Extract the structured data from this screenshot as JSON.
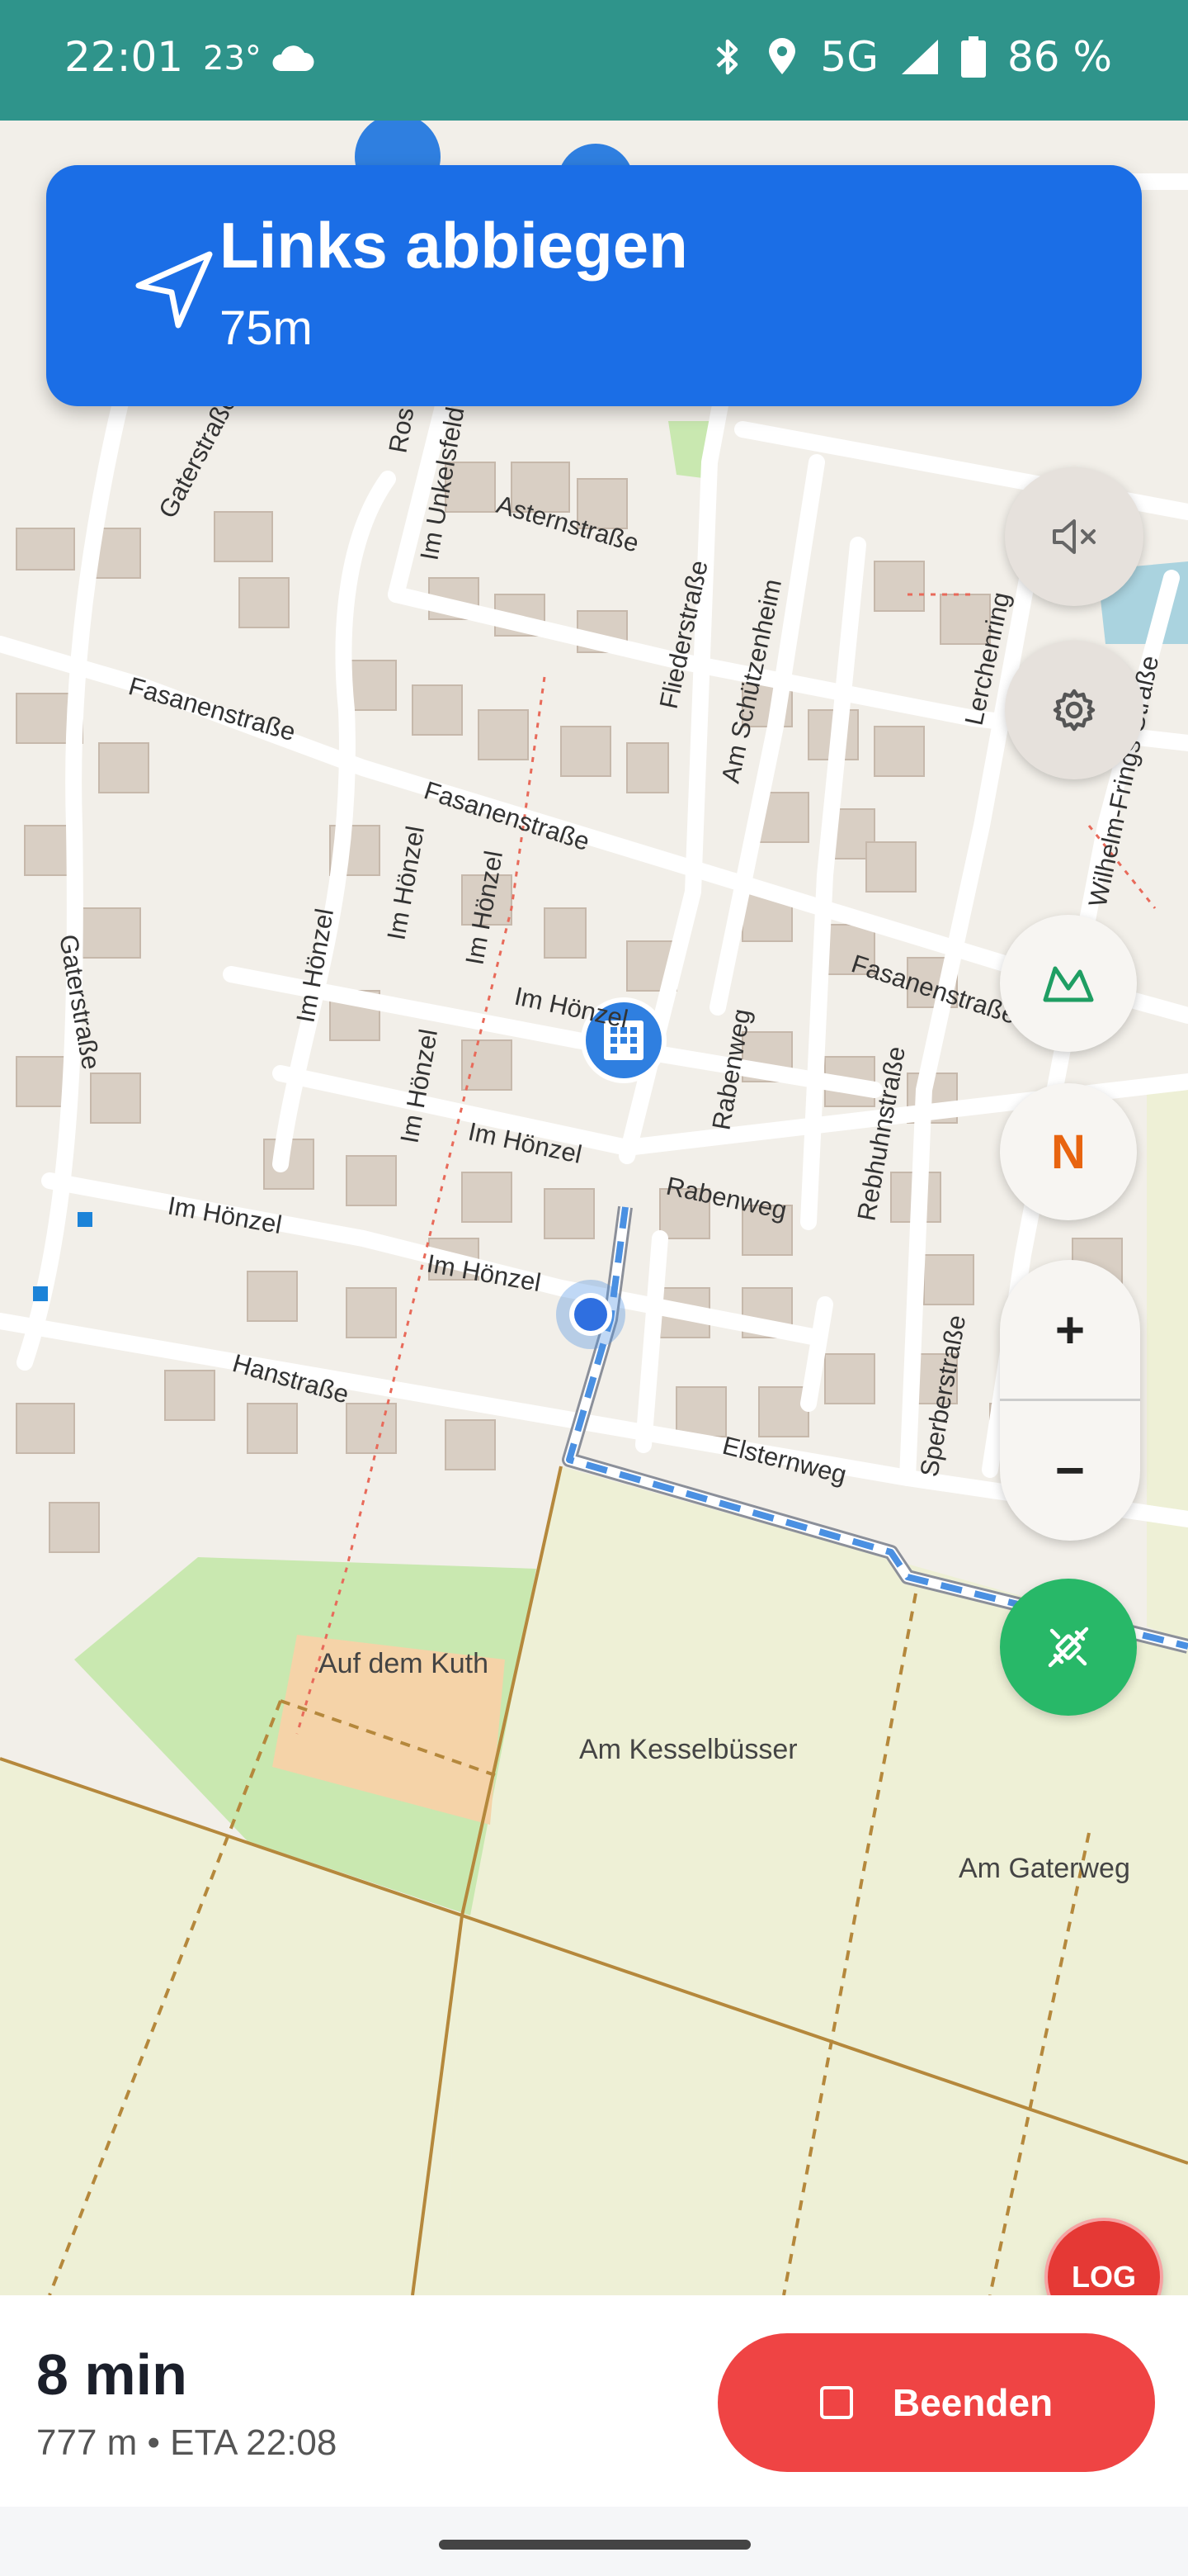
{
  "status_bar": {
    "time": "22:01",
    "temperature": "23°",
    "weather_icon": "cloud-icon",
    "network": "5G",
    "battery": "86 %",
    "icons": [
      "bluetooth-icon",
      "location-icon",
      "signal-icon",
      "battery-icon"
    ]
  },
  "navigation": {
    "instruction": "Links abbiegen",
    "distance": "75m",
    "icon": "navigation-arrow-icon"
  },
  "map": {
    "street_labels": [
      "Gaterstraße",
      "Im Unkelsfeld",
      "Asternstraße",
      "Fliederstraße",
      "Am Schützenheim",
      "Lerchenring",
      "Wilhelm-Frings-Straße",
      "Fasanenstraße",
      "Fasanenstraße",
      "Fasanenstraße",
      "Im Hönzel",
      "Im Hönzel",
      "Im Hönzel",
      "Im Hönzel",
      "Im Hönzel",
      "Im Hönzel",
      "Im Hönzel",
      "Im Hönzel",
      "Gaterstraße",
      "Rabenweg",
      "Rabenweg",
      "Rebhuhnstraße",
      "Hanstraße",
      "Elsternweg",
      "Sperberstraße",
      "Ros"
    ],
    "area_labels": [
      "Auf dem Kuth",
      "Am Kesselbüsser",
      "Am Gaterweg"
    ],
    "route_color": "#4a90e2"
  },
  "controls": {
    "mute_icon": "volume-mute-icon",
    "settings_icon": "gear-icon",
    "terrain_icon": "mountain-icon",
    "north_label": "N",
    "zoom_in": "+",
    "zoom_out": "−",
    "gps_icon": "gps-off-icon",
    "log_label": "LOG"
  },
  "route_summary": {
    "duration": "8 min",
    "details": "777 m • ETA 22:08",
    "end_button": "Beenden"
  },
  "colors": {
    "status_bar": "#2f948b",
    "banner": "#1b6ee6",
    "end_button": "#ef4444",
    "gps_button": "#28b868"
  }
}
